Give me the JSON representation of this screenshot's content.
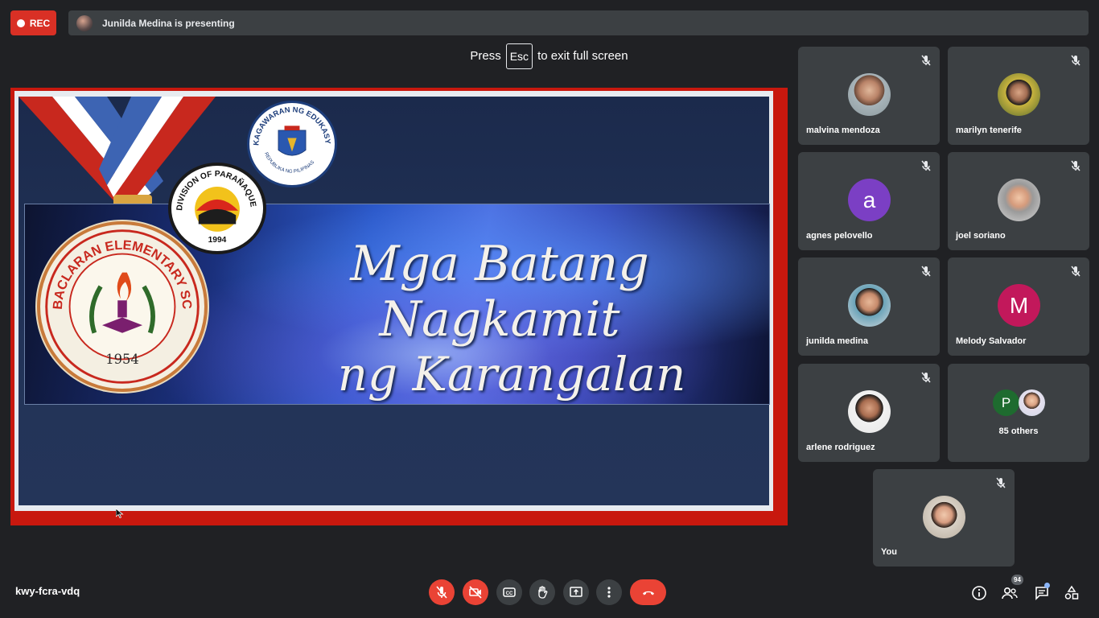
{
  "recording": {
    "label": "REC"
  },
  "presenter_bar": {
    "text": "Junilda Medina is presenting"
  },
  "fullscreen_toast": {
    "prefix": "Press",
    "key": "Esc",
    "suffix": "to exit full screen"
  },
  "slide": {
    "title_line1": "Mga Batang Nagkamit",
    "title_line2": "ng Karangalan",
    "school_seal": {
      "top_text": "BACLARAN ELEMENTARY SCHOOL UNIT I",
      "year": "1954"
    },
    "division_seal": {
      "text": "DIVISION OF PARAÑAQUE CITY",
      "year": "1994"
    },
    "deped_seal": {
      "top_text": "KAGAWARAN NG EDUKASYON",
      "bottom_text": "REPUBLIKA NG PILIPINAS"
    }
  },
  "participants": [
    {
      "name": "malvina mendoza",
      "avatar": "photo",
      "muted": true
    },
    {
      "name": "marilyn tenerife",
      "avatar": "photo",
      "muted": true
    },
    {
      "name": "agnes pelovello",
      "avatar_letter": "a",
      "avatar_color": "#7b3fc4",
      "muted": true
    },
    {
      "name": "joel soriano",
      "avatar": "photo",
      "muted": true
    },
    {
      "name": "junilda medina",
      "avatar": "photo",
      "muted": true
    },
    {
      "name": "Melody Salvador",
      "avatar_letter": "M",
      "avatar_color": "#c2185b",
      "muted": true
    },
    {
      "name": "arlene rodriguez",
      "avatar": "photo",
      "muted": true
    }
  ],
  "others_tile": {
    "letter": "P",
    "label": "85 others"
  },
  "self_tile": {
    "name": "You",
    "muted": true
  },
  "bottom_bar": {
    "meeting_code": "kwy-fcra-vdq",
    "people_count": "94"
  },
  "colors": {
    "background": "#202124",
    "tile": "#3c4043",
    "danger": "#ea4335",
    "rec": "#d93025"
  }
}
